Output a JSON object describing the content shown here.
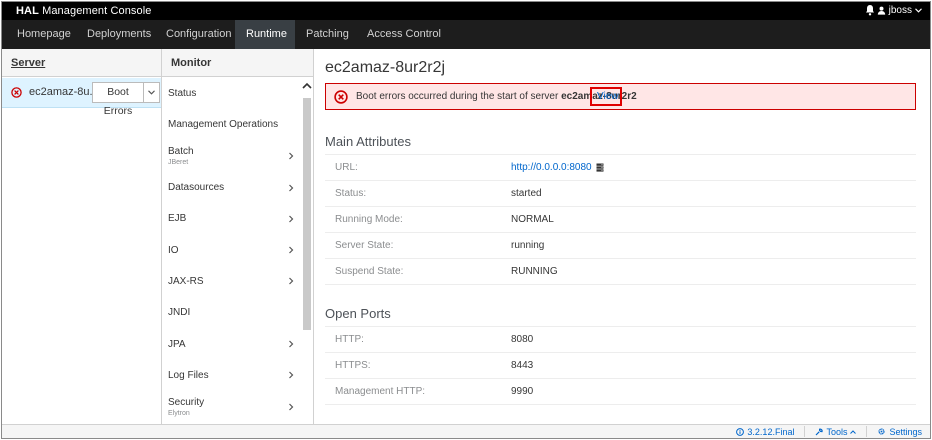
{
  "titlebar": {
    "brand_bold": "HAL",
    "brand_rest": " Management Console",
    "user": "jboss"
  },
  "nav": {
    "tabs": [
      {
        "label": "Homepage"
      },
      {
        "label": "Deployments"
      },
      {
        "label": "Configuration"
      },
      {
        "label": "Runtime",
        "active": true
      },
      {
        "label": "Patching"
      },
      {
        "label": "Access Control"
      }
    ]
  },
  "server_column": {
    "header": "Server",
    "server_name": "ec2amaz-8u...",
    "boot_errors_label": "Boot Errors"
  },
  "monitor_column": {
    "header": "Monitor",
    "items": [
      {
        "label": "Status",
        "sub": "",
        "has_children": false
      },
      {
        "label": "Management Operations",
        "sub": "",
        "has_children": false
      },
      {
        "label": "Batch",
        "sub": "JBeret",
        "has_children": true
      },
      {
        "label": "Datasources",
        "sub": "",
        "has_children": true
      },
      {
        "label": "EJB",
        "sub": "",
        "has_children": true
      },
      {
        "label": "IO",
        "sub": "",
        "has_children": true
      },
      {
        "label": "JAX-RS",
        "sub": "",
        "has_children": true
      },
      {
        "label": "JNDI",
        "sub": "",
        "has_children": false
      },
      {
        "label": "JPA",
        "sub": "",
        "has_children": true
      },
      {
        "label": "Log Files",
        "sub": "",
        "has_children": true
      },
      {
        "label": "Security",
        "sub": "Elytron",
        "has_children": true
      }
    ]
  },
  "main": {
    "title": "ec2amaz-8ur2r2j",
    "alert": {
      "message": "Boot errors occurred during the start of server ",
      "server": "ec2amaz-8ur2r2",
      "link": "View"
    },
    "main_attributes": {
      "title": "Main Attributes",
      "rows": [
        {
          "key": "URL:",
          "value": "http://0.0.0.0:8080",
          "is_link": true
        },
        {
          "key": "Status:",
          "value": "started"
        },
        {
          "key": "Running Mode:",
          "value": "NORMAL"
        },
        {
          "key": "Server State:",
          "value": "running"
        },
        {
          "key": "Suspend State:",
          "value": "RUNNING"
        }
      ]
    },
    "open_ports": {
      "title": "Open Ports",
      "rows": [
        {
          "key": "HTTP:",
          "value": "8080"
        },
        {
          "key": "HTTPS:",
          "value": "8443"
        },
        {
          "key": "Management HTTP:",
          "value": "9990"
        }
      ]
    }
  },
  "footer": {
    "version": "3.2.12.Final",
    "tools": "Tools",
    "settings": "Settings"
  },
  "colors": {
    "titlebar_bg": "#000000",
    "navbar_bg": "#1d1d1d",
    "active_tab_bg": "#393f44",
    "selected_row_bg": "#def3ff",
    "alert_bg": "#ffe6e6",
    "alert_border": "#cc0000",
    "link": "#0066cc"
  }
}
